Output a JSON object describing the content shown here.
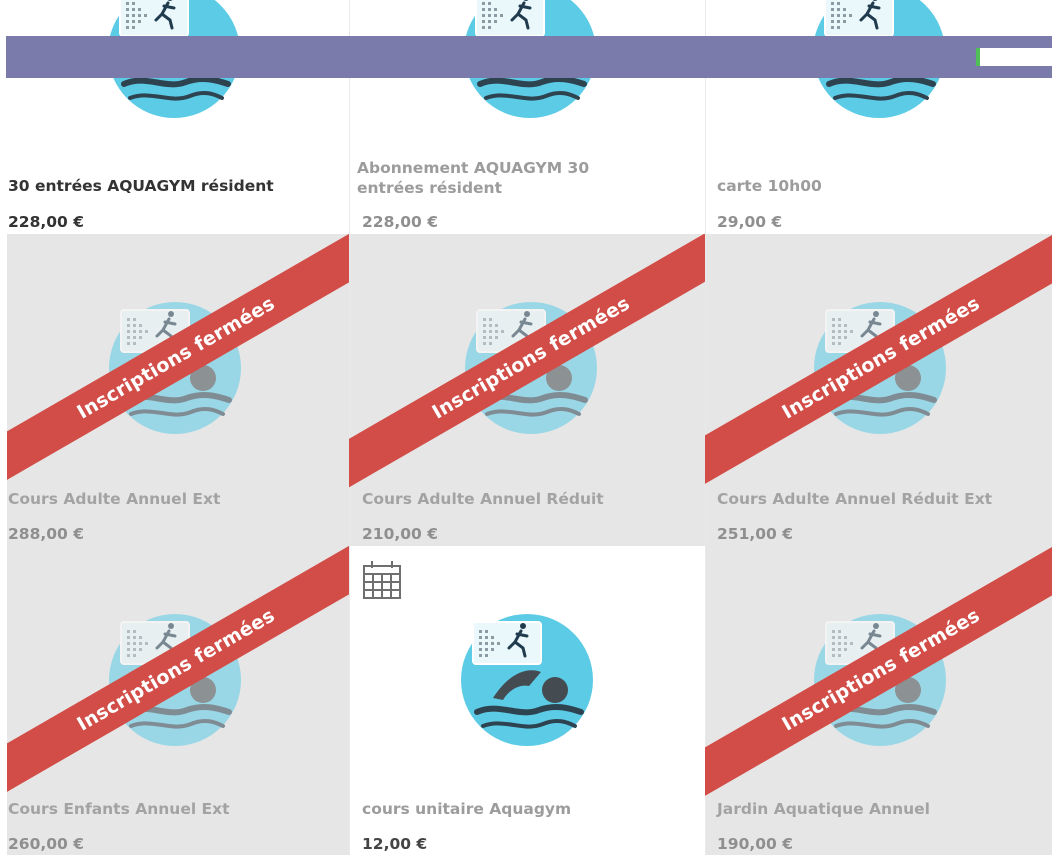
{
  "ribbon_text": "Inscriptions fermées",
  "products": [
    {
      "name": "30 entrées AQUAGYM résident",
      "price": "228,00 €"
    },
    {
      "name": "Abonnement AQUAGYM 30 entrées résident",
      "price": "228,00 €"
    },
    {
      "name": "carte 10h00",
      "price": "29,00 €"
    },
    {
      "name": "Cours Adulte Annuel Ext",
      "price": "288,00 €"
    },
    {
      "name": "Cours Adulte Annuel Réduit",
      "price": "210,00 €"
    },
    {
      "name": "Cours Adulte Annuel Réduit Ext",
      "price": "251,00 €"
    },
    {
      "name": "Cours Enfants Annuel Ext",
      "price": "260,00 €"
    },
    {
      "name": "cours unitaire Aquagym",
      "price": "12,00 €"
    },
    {
      "name": "Jardin Aquatique Annuel",
      "price": "190,00 €"
    }
  ],
  "colors": {
    "header_bar": "#7a7aab",
    "ribbon": "#d24d47",
    "logo_blue": "#5ccbe6",
    "closed_card_bg": "#e6e6e6",
    "search_accent": "#4fbf57"
  },
  "icons": {
    "logo": "swimmer-logo-icon",
    "calendar": "calendar-icon"
  }
}
